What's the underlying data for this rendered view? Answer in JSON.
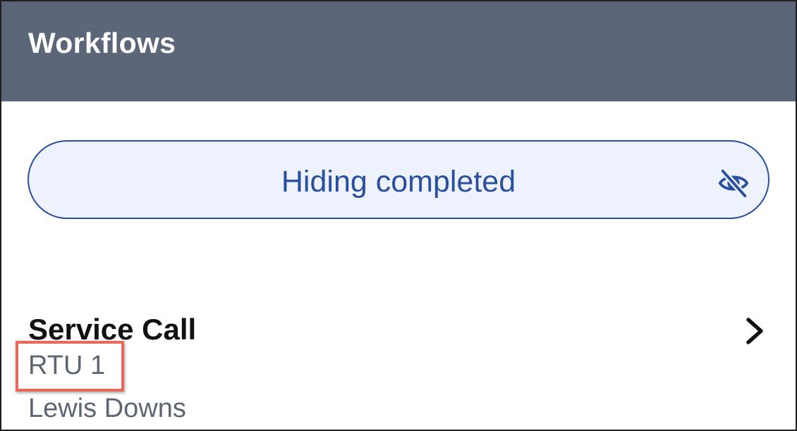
{
  "header": {
    "title": "Workflows"
  },
  "filter": {
    "label": "Hiding completed",
    "icon": "eye-off-icon",
    "accent_color": "#2a4fa0",
    "background_color": "#edf2fd"
  },
  "workflow": {
    "title": "Service Call",
    "unit": "RTU 1",
    "site": "Lewis Downs",
    "highlight_color": "#e8685a"
  },
  "colors": {
    "header_background": "#5b6678"
  }
}
